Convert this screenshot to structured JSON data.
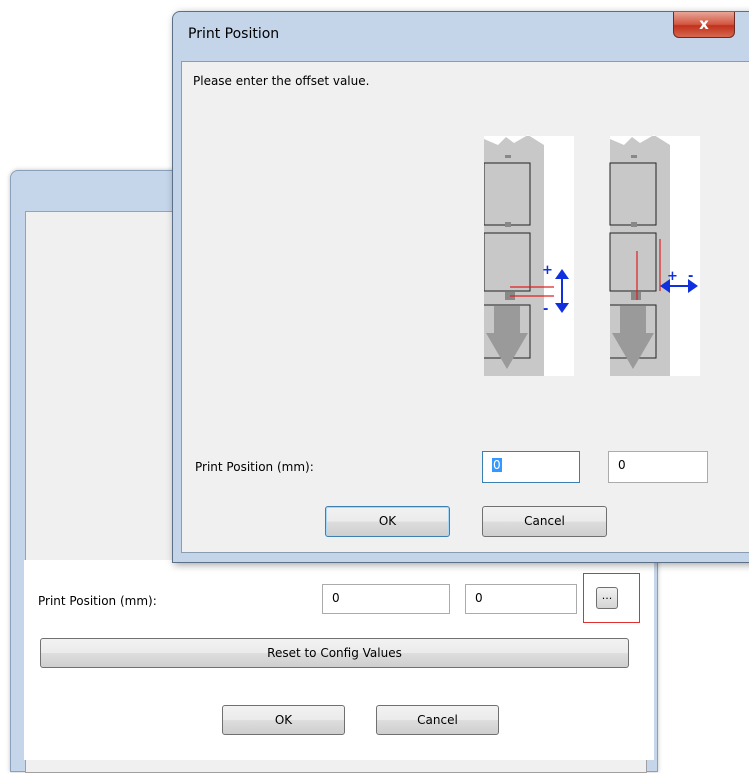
{
  "background_dialog": {
    "print_position_label": "Print Position (mm):",
    "x_value": "0",
    "y_value": "0",
    "browse_button": "...",
    "reset_button": "Reset to Config Values",
    "ok_button": "OK",
    "cancel_button": "Cancel"
  },
  "print_position_dialog": {
    "title": "Print Position",
    "close_button": "x",
    "instruction": "Please enter the offset value.",
    "print_position_label": "Print Position (mm):",
    "x_value": "0",
    "y_value": "0",
    "ok_button": "OK",
    "cancel_button": "Cancel",
    "diagram": {
      "vertical_plus": "+",
      "vertical_minus": "-",
      "horizontal_plus": "+",
      "horizontal_minus": "-"
    }
  },
  "colors": {
    "offset_line": "#e02020",
    "arrow": "#1030e0",
    "label_gray": "#c8c8c8",
    "highlight": "#e03030"
  }
}
